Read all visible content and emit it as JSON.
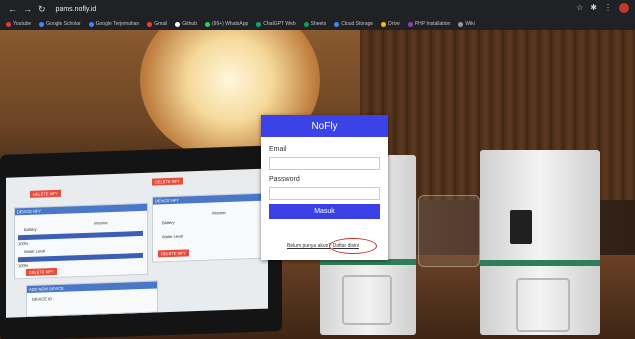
{
  "browser": {
    "url": "pams.nofly.id",
    "bookmarks": [
      "Youtube",
      "Google Scholar",
      "Google Terjemahan",
      "Gmail",
      "Github",
      "(99+) WhatsApp",
      "ChatGPT Web",
      "Sheets",
      "Cloud Storage",
      "Drive",
      "PHP Installation",
      "Wiki"
    ]
  },
  "login": {
    "title": "NoFly",
    "email_label": "Email",
    "email_value": "",
    "password_label": "Password",
    "password_value": "",
    "submit_label": "Masuk",
    "register_link": "Belum punya akun?",
    "register_action": "Daftar disini"
  },
  "tablet": {
    "delete_nfy": "DELETE NFY",
    "device_nfy": "DEVICE NFY",
    "battery": "Battery",
    "internet": "Internet",
    "water_level": "Water Level",
    "add_device": "ADD NEW DEVICE",
    "device_id": "DEVICE ID",
    "battery_pct": "100%",
    "water_pct": "100%"
  },
  "colors": {
    "accent": "#3b43e8",
    "danger": "#e74c3c",
    "device_band": "#2e7d5b"
  }
}
